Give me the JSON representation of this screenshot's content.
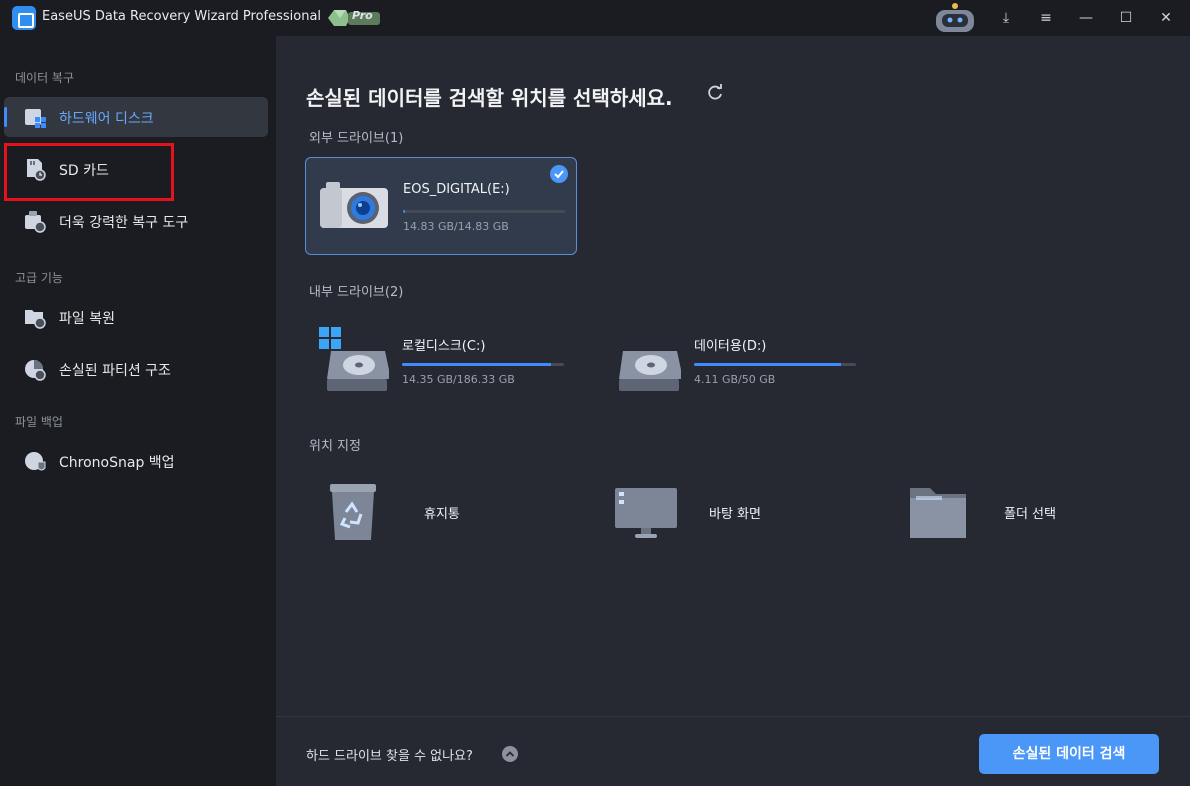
{
  "app": {
    "title": "EaseUS Data Recovery Wizard Professional",
    "badge": "Pro"
  },
  "window_controls": {
    "download": "⤓",
    "menu": "≡",
    "minimize": "—",
    "maximize": "☐",
    "close": "✕"
  },
  "sidebar": {
    "sections": [
      {
        "label": "데이터 복구"
      },
      {
        "label": "고급 기능"
      },
      {
        "label": "파일 백업"
      }
    ],
    "items": [
      {
        "label": "하드웨어 디스크",
        "icon": "hard-disk-icon",
        "active": true
      },
      {
        "label": "SD 카드",
        "icon": "sd-card-icon",
        "active": false
      },
      {
        "label": "더욱 강력한 복구 도구",
        "icon": "recovery-tools-icon",
        "active": false
      },
      {
        "label": "파일 복원",
        "icon": "file-restore-icon",
        "active": false
      },
      {
        "label": "손실된 파티션 구조",
        "icon": "partition-icon",
        "active": false
      },
      {
        "label": "ChronoSnap 백업",
        "icon": "chronosnap-icon",
        "active": false
      }
    ]
  },
  "main": {
    "title": "손실된 데이터를 검색할 위치를 선택하세요.",
    "external": {
      "label": "외부 드라이브(1)",
      "drives": [
        {
          "name": "EOS_DIGITAL(E:)",
          "size": "14.83 GB/14.83 GB",
          "used_fraction": 0.01,
          "selected": true
        }
      ]
    },
    "internal": {
      "label": "내부 드라이브(2)",
      "drives": [
        {
          "name": "로컬디스크(C:)",
          "size": "14.35 GB/186.33 GB",
          "used_fraction": 0.92
        },
        {
          "name": "데이터용(D:)",
          "size": "4.11 GB/50 GB",
          "used_fraction": 0.91
        }
      ]
    },
    "locations": {
      "label": "위치 지정",
      "items": [
        {
          "label": "휴지통",
          "icon": "recycle-bin-icon"
        },
        {
          "label": "바탕 화면",
          "icon": "desktop-icon"
        },
        {
          "label": "폴더 선택",
          "icon": "folder-icon"
        }
      ]
    },
    "footer": {
      "cant_find": "하드 드라이브 찾을 수 없나요?",
      "scan_button": "손실된 데이터 검색"
    }
  },
  "colors": {
    "accent": "#4b97f7",
    "highlight_box": "#e3121b",
    "sidebar_bg": "#1a1c21",
    "main_bg": "#262931"
  }
}
